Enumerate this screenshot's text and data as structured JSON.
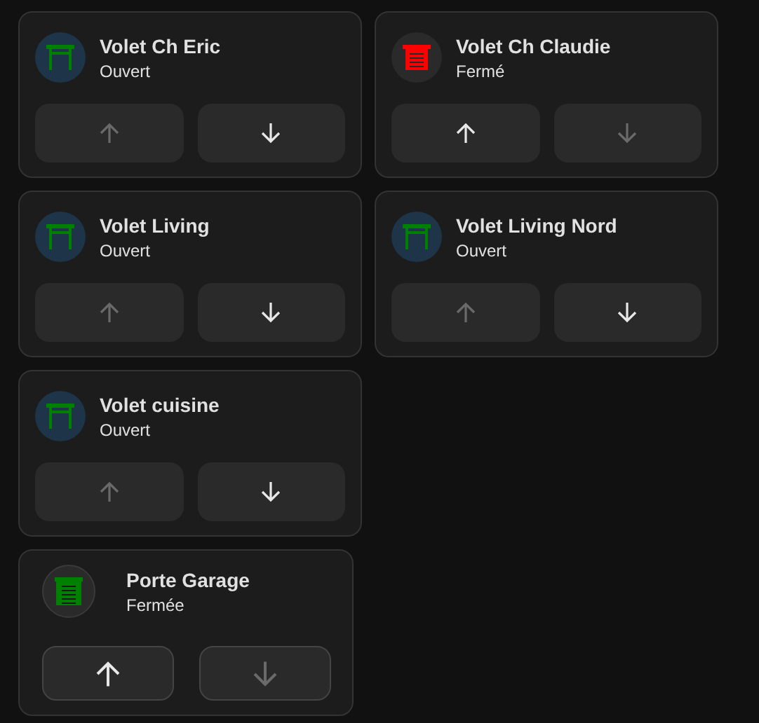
{
  "cards": [
    {
      "kind": "shutter",
      "name": "Volet Ch Eric",
      "state": "Ouvert",
      "open": true,
      "color": "#008000",
      "up_disabled": true,
      "down_disabled": false
    },
    {
      "kind": "shutter",
      "name": "Volet Ch Claudie",
      "state": "Fermé",
      "open": false,
      "color": "#ff0000",
      "up_disabled": false,
      "down_disabled": true
    },
    {
      "kind": "shutter",
      "name": "Volet Living",
      "state": "Ouvert",
      "open": true,
      "color": "#008000",
      "up_disabled": true,
      "down_disabled": false
    },
    {
      "kind": "shutter",
      "name": "Volet Living Nord",
      "state": "Ouvert",
      "open": true,
      "color": "#008000",
      "up_disabled": true,
      "down_disabled": false
    },
    {
      "kind": "shutter",
      "name": "Volet cuisine",
      "state": "Ouvert",
      "open": true,
      "color": "#008000",
      "up_disabled": true,
      "down_disabled": false
    }
  ],
  "garage": {
    "kind": "garage",
    "name": "Porte Garage",
    "state": "Fermée",
    "open": false,
    "color": "#008000",
    "up_disabled": false,
    "down_disabled": true
  }
}
